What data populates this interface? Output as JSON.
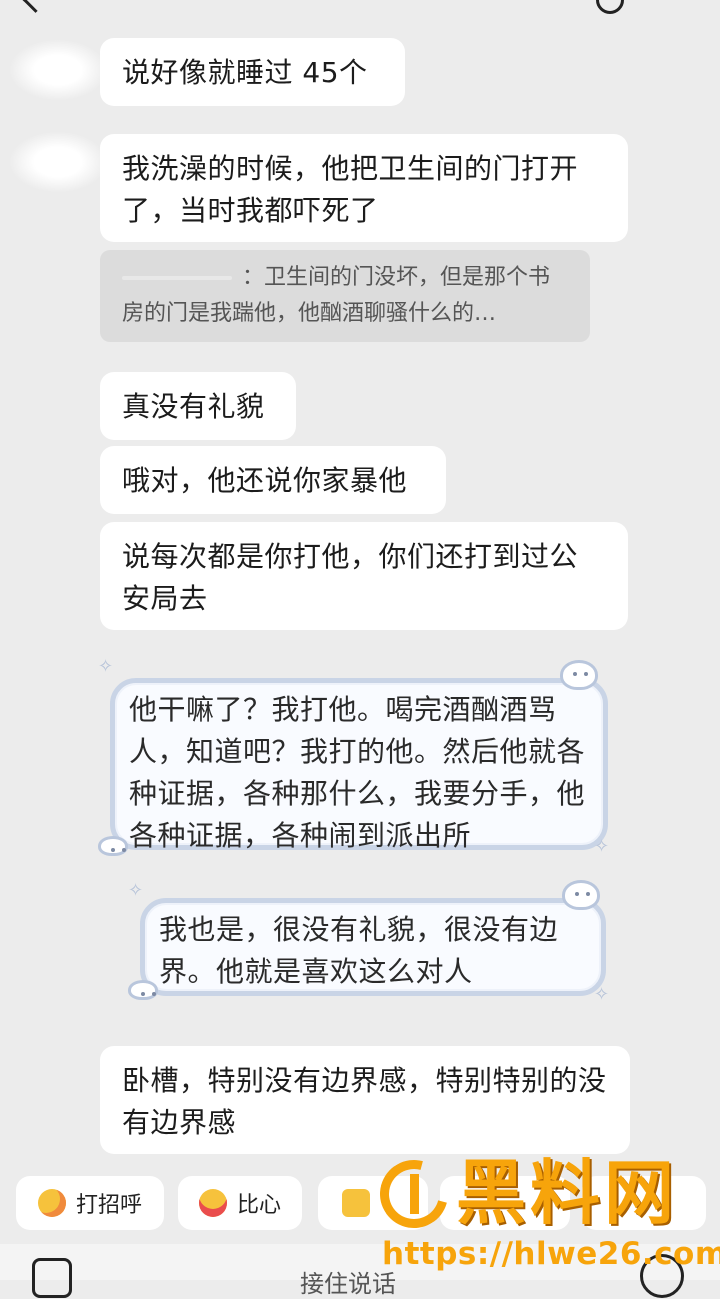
{
  "messages": [
    {
      "text": "说好像就睡过 45个"
    },
    {
      "text": "我洗澡的时候，他把卫生间的门打开了，当时我都吓死了"
    },
    {
      "text": "真没有礼貌"
    },
    {
      "text": "哦对，他还说你家暴他"
    },
    {
      "text": "说每次都是你打他，你们还打到过公安局去"
    },
    {
      "text": "卧槽，特别没有边界感，特别特别的没有边界感"
    }
  ],
  "quote": {
    "text": "：卫生间的门没坏，但是那个书房的门是我踹他，他酗酒聊骚什么的…"
  },
  "styled_messages": [
    {
      "text": "他干嘛了？我打他。喝完酒酗酒骂人，知道吧？我打的他。然后他就各种证据，各种那什么，我要分手，他各种证据，各种闹到派出所"
    },
    {
      "text": "我也是，很没有礼貌，很没有边界。他就是喜欢这么对人"
    }
  ],
  "quick_replies": [
    {
      "label": "打招呼",
      "icon": "waving-face-icon"
    },
    {
      "label": "比心",
      "icon": "heart-hands-face-icon"
    },
    {
      "label": "",
      "icon": "thumbs-up-icon"
    }
  ],
  "input": {
    "placeholder": "接住说话"
  },
  "watermark": {
    "title": "黑料网",
    "url": "https://hlwe26.com"
  },
  "colors": {
    "background": "#ececec",
    "bubble": "#ffffff",
    "watermark": "#f7a40b"
  }
}
